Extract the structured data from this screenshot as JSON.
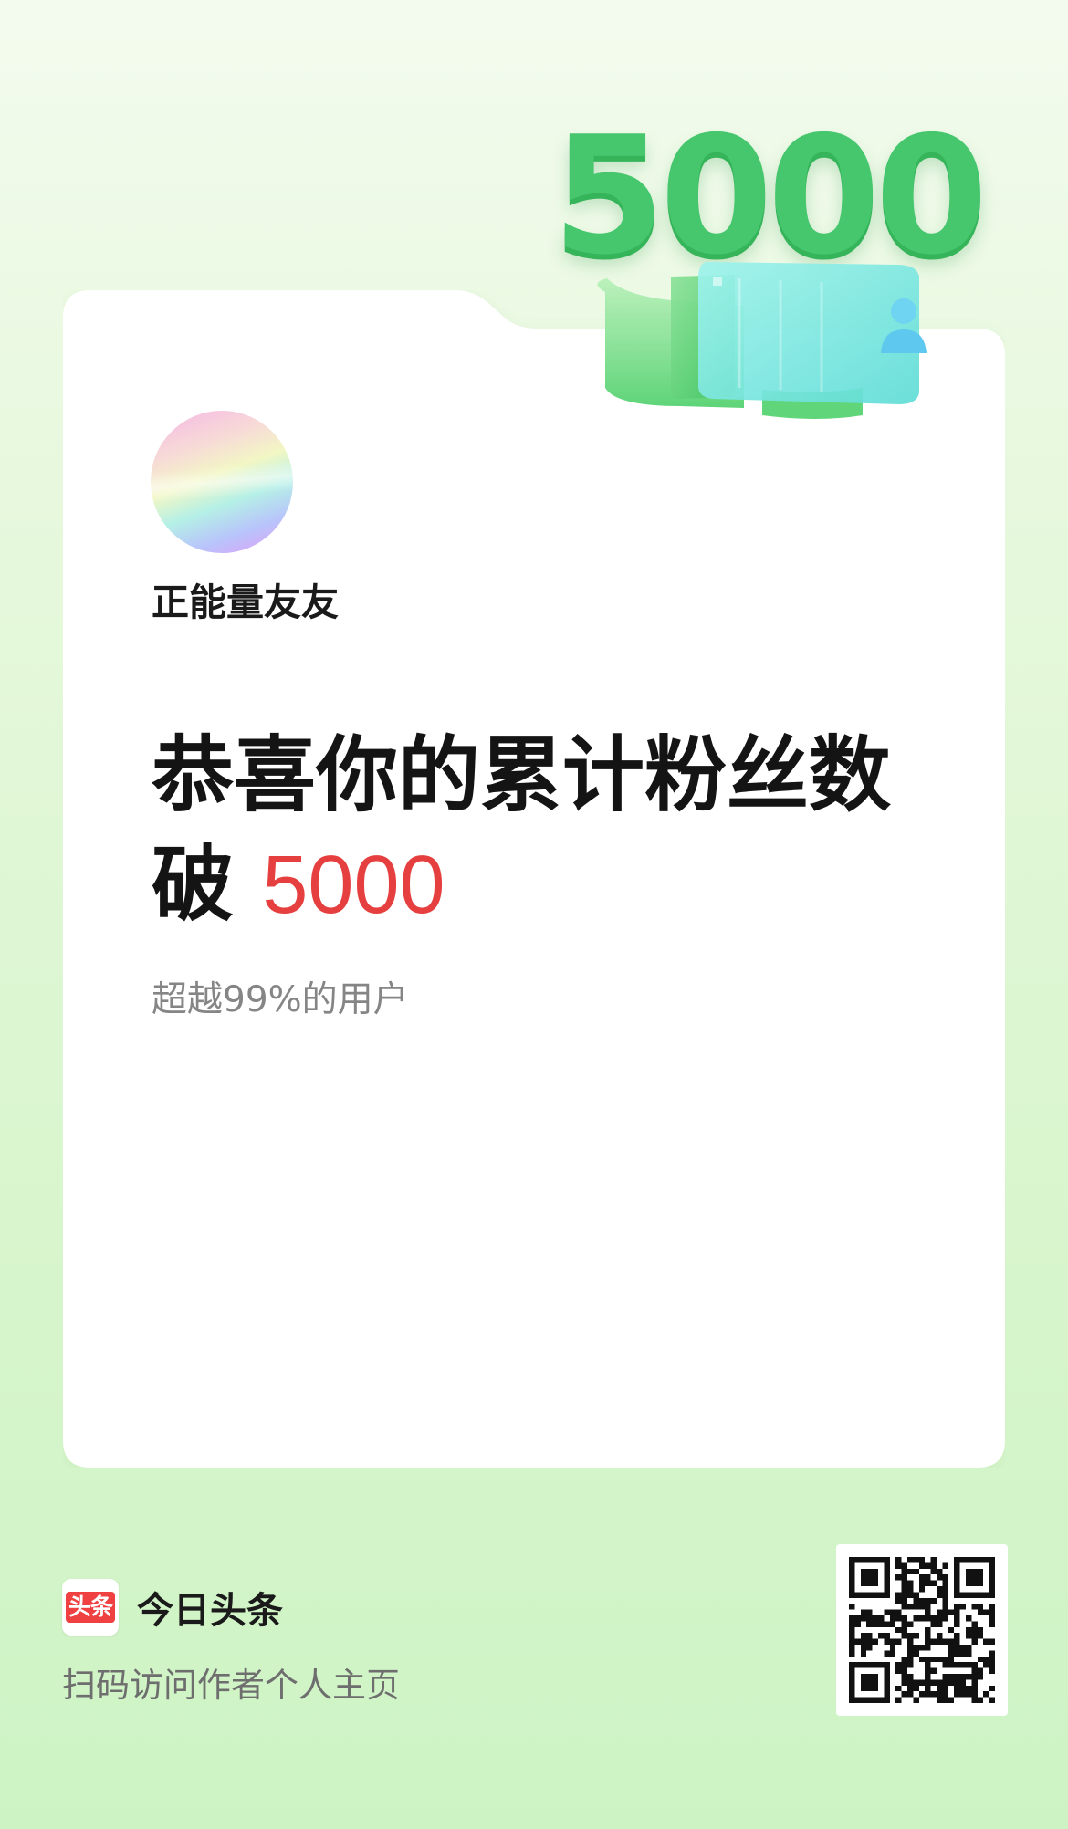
{
  "milestone": {
    "badge_number": "5000"
  },
  "profile": {
    "username": "正能量友友"
  },
  "headline": {
    "line1": "恭喜你的累计粉丝数",
    "line2_prefix": "破",
    "line2_number": "5000"
  },
  "stat": {
    "text": "超越99%的用户"
  },
  "footer": {
    "logo_text": "头条",
    "app_name": "今日头条",
    "scan_text": "扫码访问作者个人主页"
  },
  "colors": {
    "accent_red": "#e5403f",
    "brand_red": "#f04142",
    "badge_green": "#46c66d"
  }
}
